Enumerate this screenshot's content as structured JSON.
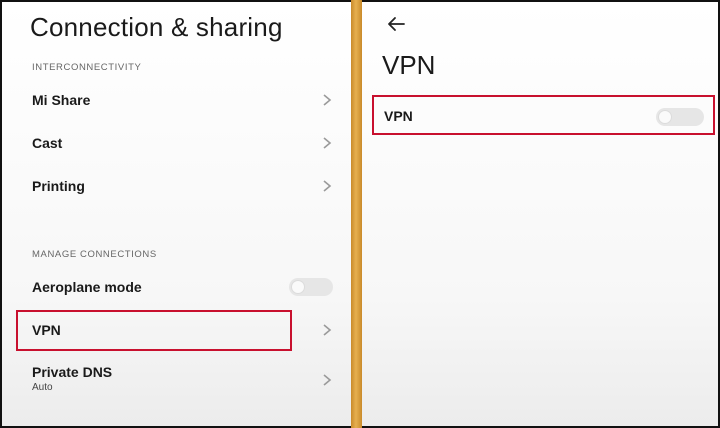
{
  "left_screen": {
    "title": "Connection & sharing",
    "sections": [
      {
        "header": "INTERCONNECTIVITY",
        "items": [
          {
            "label": "Mi Share",
            "control": "chevron"
          },
          {
            "label": "Cast",
            "control": "chevron"
          },
          {
            "label": "Printing",
            "control": "chevron"
          }
        ]
      },
      {
        "header": "MANAGE CONNECTIONS",
        "items": [
          {
            "label": "Aeroplane mode",
            "control": "toggle",
            "enabled": false
          },
          {
            "label": "VPN",
            "control": "chevron",
            "highlighted": true
          },
          {
            "label": "Private DNS",
            "sublabel": "Auto",
            "control": "chevron"
          }
        ]
      }
    ]
  },
  "right_screen": {
    "back_icon": "arrow-left-icon",
    "title": "VPN",
    "items": [
      {
        "label": "VPN",
        "control": "toggle",
        "enabled": false,
        "highlighted": true
      }
    ]
  },
  "colors": {
    "highlight": "#c8102e",
    "divider": "#e6b050",
    "toggle_off": "#e6e6e6"
  }
}
